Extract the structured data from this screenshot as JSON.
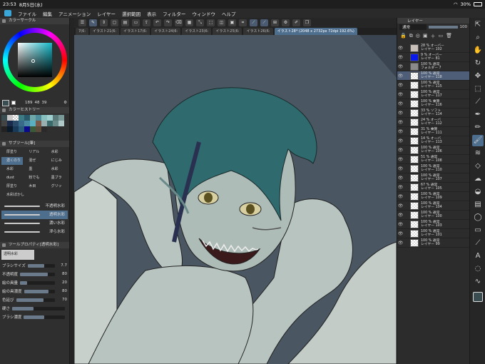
{
  "status": {
    "time": "23:53",
    "date": "8月5日(水)",
    "battery": "30%"
  },
  "menu": [
    "ファイル",
    "編集",
    "アニメーション",
    "レイヤー",
    "選択範囲",
    "表示",
    "フィルター",
    "ウィンドウ",
    "ヘルプ"
  ],
  "color_circle": {
    "title": "カラーサークル",
    "h": "189",
    "s": "48",
    "v": "39"
  },
  "color_history": {
    "title": "カラーヒストリー"
  },
  "subtool": {
    "title": "サブツール[筆]",
    "items": [
      "厚塗り",
      "リアル",
      "水彩",
      "濃くのり",
      "混ぜ",
      "墨",
      "にじみ",
      "水彩",
      "dust",
      "粉でも",
      "墨ブラ",
      "厚塗り",
      "ガッシュ",
      "水彩ブ",
      "油彩",
      "木目",
      "水彩",
      "粗毛",
      "グリッ",
      "水彩ぼかし"
    ],
    "brushes": [
      "不透明水彩",
      "透明水彩",
      "濃い水彩",
      "滲ら水彩"
    ]
  },
  "toolprop": {
    "title": "ツールプロパティ[透明水彩]",
    "name": "透明水彩",
    "rows": [
      {
        "label": "ブラシサイズ",
        "value": "7.7",
        "frac": 0.6
      },
      {
        "label": "不透明度",
        "value": "80",
        "frac": 0.8
      },
      {
        "label": "絵の具量",
        "value": "20",
        "frac": 0.2
      },
      {
        "label": "絵の具濃度",
        "value": "80",
        "frac": 0.8
      },
      {
        "label": "色延び",
        "value": "70",
        "frac": 0.7
      },
      {
        "label": "硬さ",
        "value": "",
        "frac": 0.4
      },
      {
        "label": "ブラシ濃度",
        "value": "",
        "frac": 0.5
      }
    ]
  },
  "tabs": [
    "7(6:",
    "イラスト21(6:",
    "イラスト17(6:",
    "イラスト24(6:",
    "イラスト23(6:",
    "イラスト25(6:",
    "イラスト26(6:",
    "イラスト28* (2048 x 2732px 72dpi 192.6%)"
  ],
  "layers": {
    "title": "レイヤー",
    "blend": "通常",
    "opacity": "100",
    "items": [
      {
        "pct": "28 %",
        "mode": "オーバー",
        "name": "レイヤー 102"
      },
      {
        "pct": "9 %",
        "mode": "オーバー",
        "name": "レイヤー 81"
      },
      {
        "pct": "100 %",
        "mode": "通常",
        "name": "フォルダー 7"
      },
      {
        "pct": "100 %",
        "mode": "通常",
        "name": "レイヤー 118"
      },
      {
        "pct": "100 %",
        "mode": "通常",
        "name": "レイヤー 115"
      },
      {
        "pct": "100 %",
        "mode": "通常",
        "name": "レイヤー 117"
      },
      {
        "pct": "100 %",
        "mode": "乗算",
        "name": "レイヤー 116"
      },
      {
        "pct": "33 %",
        "mode": "ソフト",
        "name": "レイヤー 114"
      },
      {
        "pct": "24 %",
        "mode": "オーバ",
        "name": "レイヤー 112"
      },
      {
        "pct": "31 %",
        "mode": "乗算",
        "name": "レイヤー 111"
      },
      {
        "pct": "14 %",
        "mode": "オーバ",
        "name": "レイヤー 113"
      },
      {
        "pct": "100 %",
        "mode": "通常",
        "name": "レイヤー 106"
      },
      {
        "pct": "51 %",
        "mode": "通常",
        "name": "レイヤー 108"
      },
      {
        "pct": "100 %",
        "mode": "通常",
        "name": "レイヤー 110"
      },
      {
        "pct": "100 %",
        "mode": "通常",
        "name": "レイヤー 107"
      },
      {
        "pct": "67 %",
        "mode": "通常",
        "name": "レイヤー 105"
      },
      {
        "pct": "100 %",
        "mode": "通常",
        "name": "レイヤー 109"
      },
      {
        "pct": "100 %",
        "mode": "通常",
        "name": "レイヤー 104"
      },
      {
        "pct": "100 %",
        "mode": "通常",
        "name": "レイヤー 100"
      },
      {
        "pct": "100 %",
        "mode": "通常",
        "name": "レイヤー 103"
      },
      {
        "pct": "100 %",
        "mode": "通常",
        "name": "レイヤー 101"
      },
      {
        "pct": "100 %",
        "mode": "通常",
        "name": "レイヤー 99"
      }
    ]
  },
  "colors": {
    "accent": "#4e6e8e",
    "bg": "#2f2f2f",
    "canvas": "#4a5662",
    "selected_color": "#3a4e52"
  }
}
